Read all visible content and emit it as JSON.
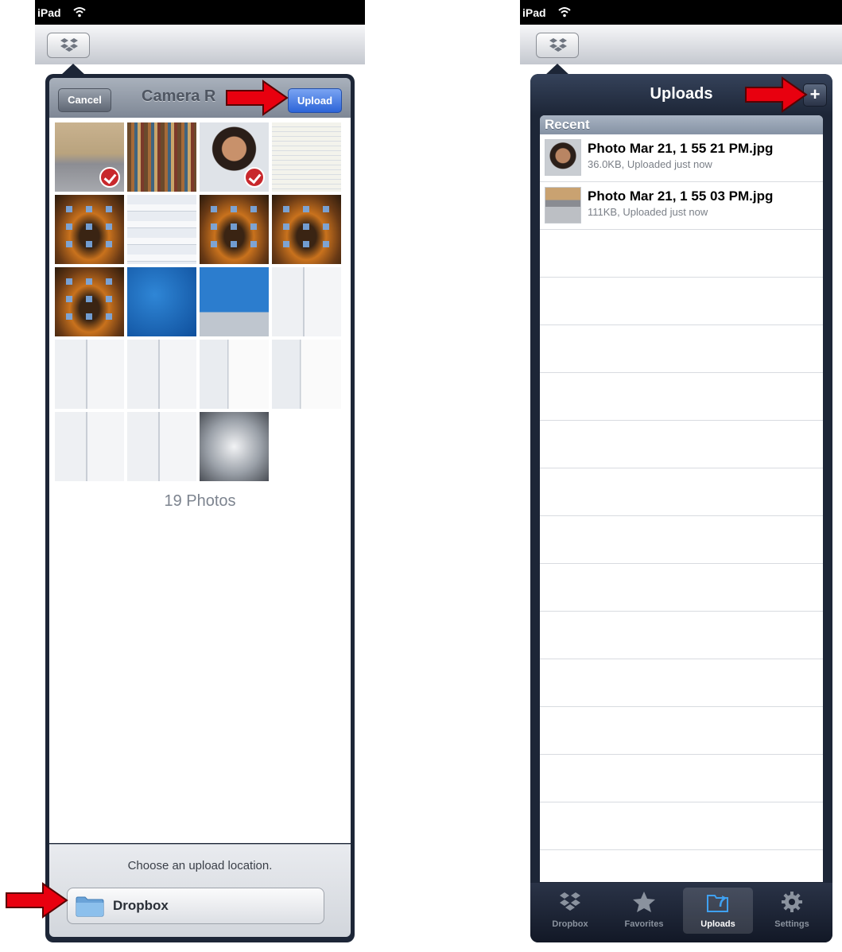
{
  "left_screen": {
    "status_carrier": "iPad",
    "nav_title": "Camera R",
    "cancel_label": "Cancel",
    "upload_label": "Upload",
    "photos": [
      {
        "kind": "cam",
        "selected": true
      },
      {
        "kind": "books",
        "selected": false
      },
      {
        "kind": "face",
        "selected": true
      },
      {
        "kind": "note",
        "selected": false
      },
      {
        "kind": "ipad",
        "selected": false
      },
      {
        "kind": "list",
        "selected": false
      },
      {
        "kind": "ipad",
        "selected": false
      },
      {
        "kind": "ipad",
        "selected": false
      },
      {
        "kind": "ipad",
        "selected": false
      },
      {
        "kind": "dbblue",
        "selected": false
      },
      {
        "kind": "kbd",
        "selected": false
      },
      {
        "kind": "split",
        "selected": false
      },
      {
        "kind": "split",
        "selected": false
      },
      {
        "kind": "split",
        "selected": false
      },
      {
        "kind": "splitdoc",
        "selected": false
      },
      {
        "kind": "splitdoc",
        "selected": false
      },
      {
        "kind": "split",
        "selected": false
      },
      {
        "kind": "split",
        "selected": false
      },
      {
        "kind": "dark",
        "selected": false
      }
    ],
    "photo_count": "19 Photos",
    "upload_hint": "Choose an upload location.",
    "location_label": "Dropbox"
  },
  "right_screen": {
    "status_carrier": "iPad",
    "nav_title": "Uploads",
    "add_label": "+",
    "section_header": "Recent",
    "uploads": [
      {
        "name": "Photo Mar 21, 1 55 21 PM.jpg",
        "meta": "36.0KB, Uploaded just now",
        "thumb": "face"
      },
      {
        "name": "Photo Mar 21, 1 55 03 PM.jpg",
        "meta": "111KB, Uploaded just now",
        "thumb": "books"
      }
    ],
    "tabs": [
      {
        "label": "Dropbox",
        "icon": "dropbox-icon",
        "selected": false
      },
      {
        "label": "Favorites",
        "icon": "star-icon",
        "selected": false
      },
      {
        "label": "Uploads",
        "icon": "upload-folder-icon",
        "selected": true
      },
      {
        "label": "Settings",
        "icon": "gear-icon",
        "selected": false
      }
    ]
  },
  "colors": {
    "annotation_arrow": "#e8000f",
    "upload_button": "#2c64d8",
    "popover_frame": "#1d2637"
  }
}
